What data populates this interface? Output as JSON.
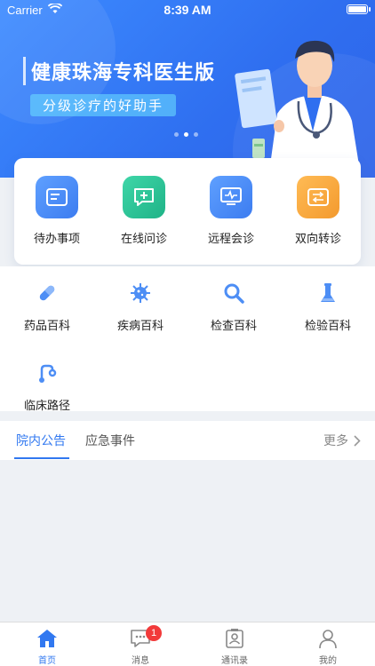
{
  "status_bar": {
    "carrier": "Carrier",
    "time": "8:39 AM"
  },
  "banner": {
    "title": "健康珠海专科医生版",
    "subtitle": "分级诊疗的好助手",
    "slide_count": 3,
    "active_slide": 2
  },
  "quick_actions": [
    {
      "label": "待办事项",
      "icon": "todo-card-icon",
      "color": "#4d8ef5"
    },
    {
      "label": "在线问诊",
      "icon": "chat-plus-icon",
      "color": "#28c497"
    },
    {
      "label": "远程会诊",
      "icon": "monitor-pulse-icon",
      "color": "#4d8ef5"
    },
    {
      "label": "双向转诊",
      "icon": "transfer-arrows-icon",
      "color": "#f7a63c"
    }
  ],
  "encyclopedia": [
    {
      "label": "药品百科",
      "icon": "pill-icon"
    },
    {
      "label": "疾病百科",
      "icon": "virus-icon"
    },
    {
      "label": "检查百科",
      "icon": "magnifier-icon"
    },
    {
      "label": "检验百科",
      "icon": "test-tube-icon"
    },
    {
      "label": "临床路径",
      "icon": "route-icon"
    }
  ],
  "tabs": {
    "items": [
      "院内公告",
      "应急事件"
    ],
    "active": 0,
    "more_label": "更多"
  },
  "bottom_nav": {
    "items": [
      {
        "label": "首页",
        "icon": "home-icon"
      },
      {
        "label": "消息",
        "icon": "message-icon"
      },
      {
        "label": "通讯录",
        "icon": "contacts-icon"
      },
      {
        "label": "我的",
        "icon": "user-icon"
      }
    ],
    "active": 0,
    "message_badge": "1"
  },
  "colors": {
    "accent": "#3178f0",
    "badge": "#f23a3a"
  }
}
